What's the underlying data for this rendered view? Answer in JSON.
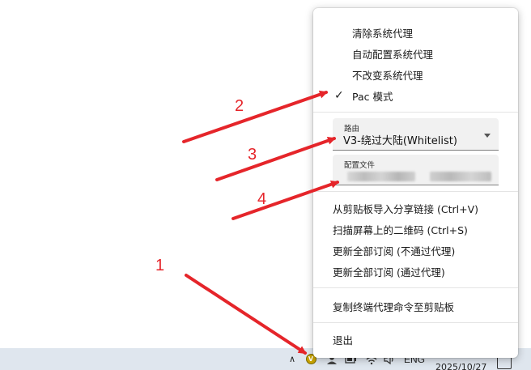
{
  "menu": {
    "proxy_items": [
      {
        "label": "清除系统代理",
        "checked": false
      },
      {
        "label": "自动配置系统代理",
        "checked": false
      },
      {
        "label": "不改变系统代理",
        "checked": false
      },
      {
        "label": "Pac 模式",
        "checked": true
      }
    ],
    "check_glyph": "✓",
    "route_field": {
      "label": "路由",
      "value": "V3-绕过大陆(Whitelist)"
    },
    "config_field": {
      "label": "配置文件",
      "value_redacted": true
    },
    "subscription_items": [
      {
        "label": "从剪贴板导入分享链接 (Ctrl+V)"
      },
      {
        "label": "扫描屏幕上的二维码 (Ctrl+S)"
      },
      {
        "label": "更新全部订阅 (不通过代理)"
      },
      {
        "label": "更新全部订阅 (通过代理)"
      }
    ],
    "copy_item": {
      "label": "复制终端代理命令至剪贴板"
    },
    "exit_item": {
      "label": "退出"
    }
  },
  "taskbar": {
    "chevron_glyph": "∧",
    "app_icon": "v2rayn-tray-icon",
    "app_glyph": "V",
    "language": "ENG",
    "clock_text": "2025/10/27"
  },
  "annotations": {
    "color": "#e5252a",
    "labels": [
      "1",
      "2",
      "3",
      "4"
    ]
  }
}
